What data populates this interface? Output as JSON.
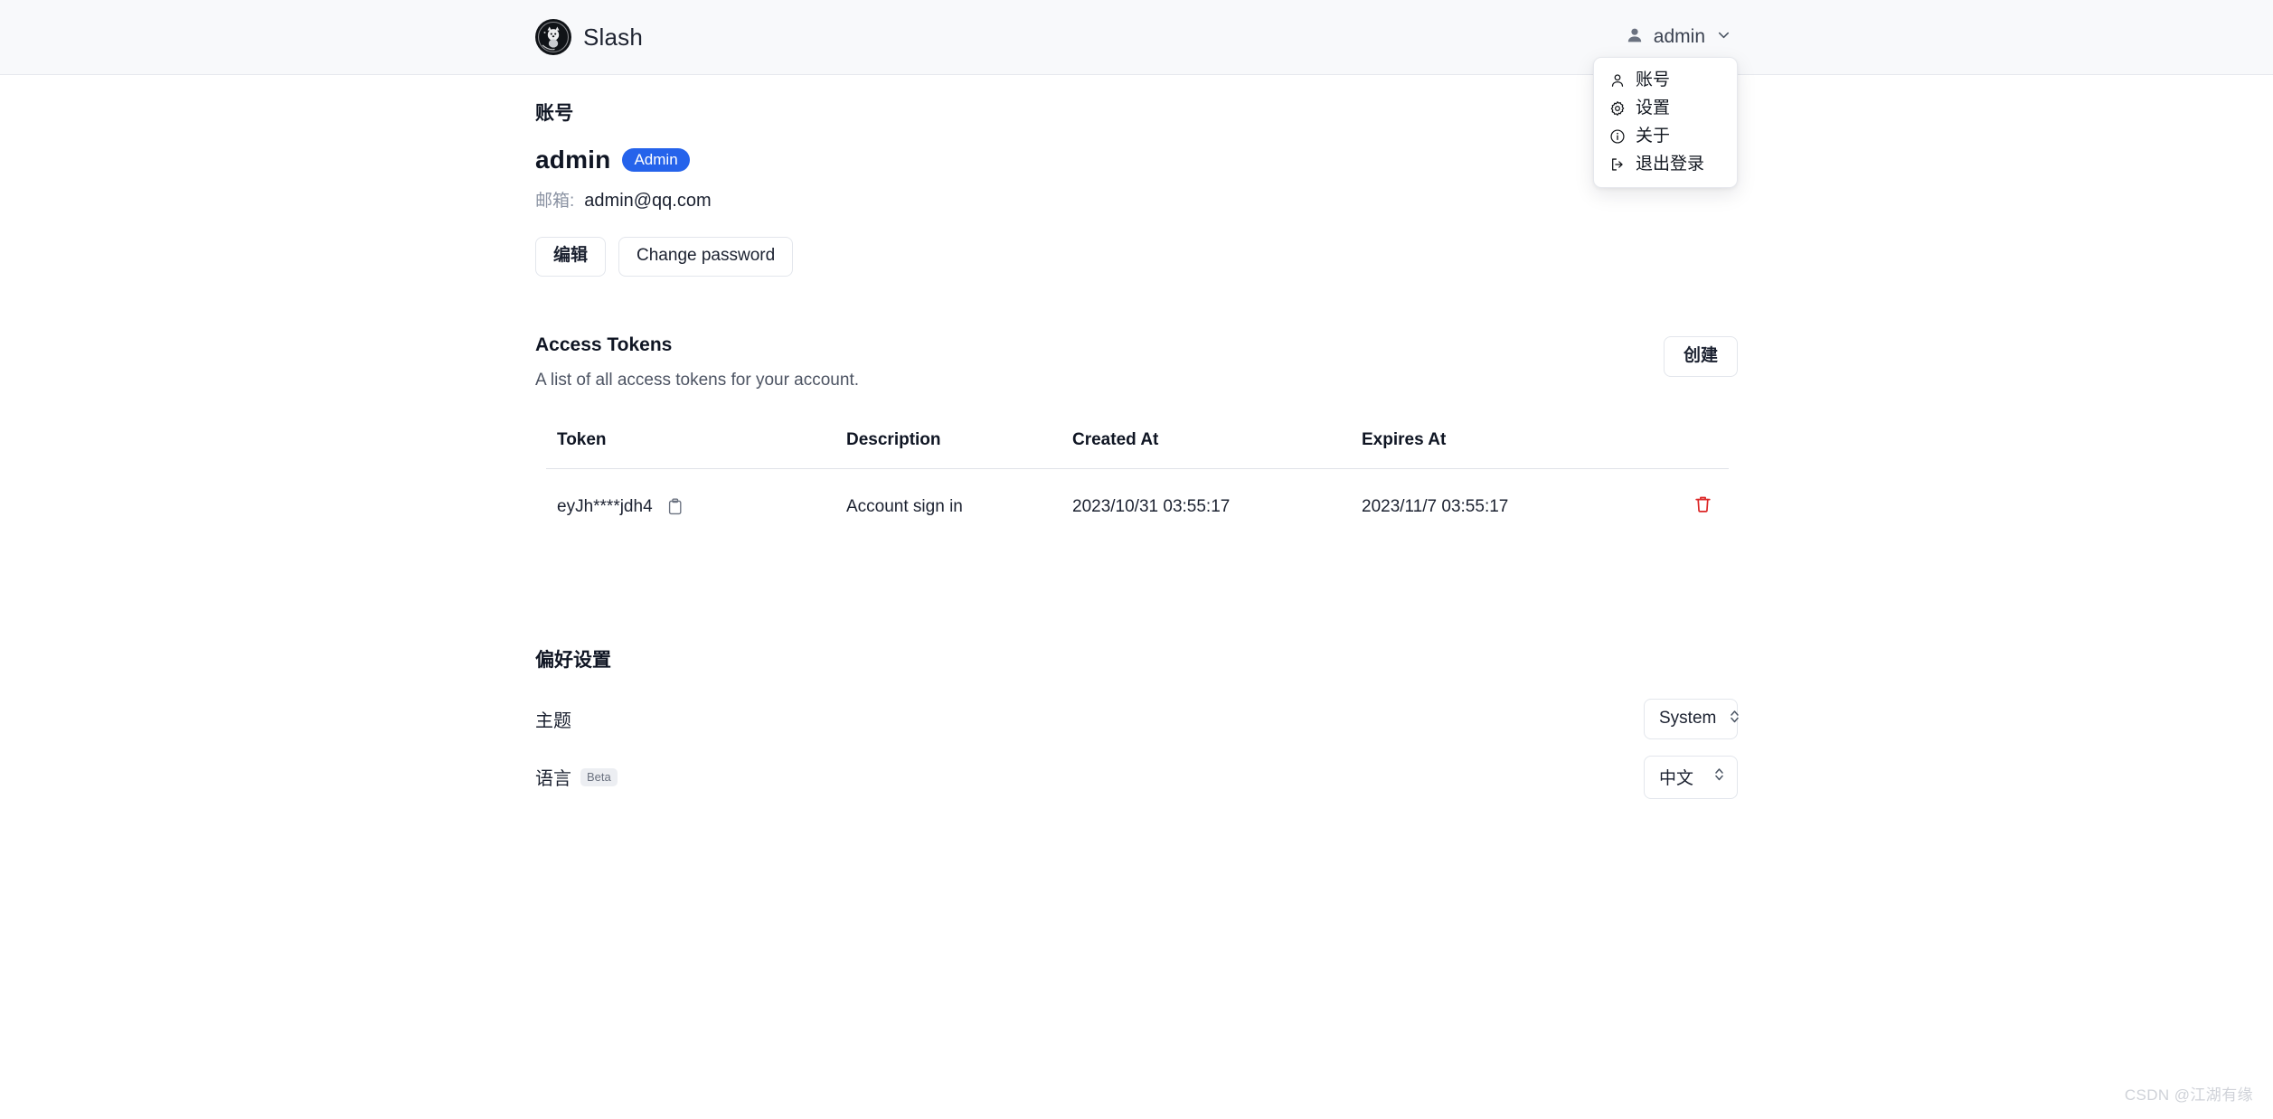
{
  "header": {
    "brand_name": "Slash",
    "logo_icon": "corgi-circle-logo",
    "user_name": "admin",
    "user_icon": "person-filled-icon",
    "chevron_icon": "chevron-down-icon"
  },
  "user_dropdown": {
    "items": [
      {
        "label": "账号",
        "icon": "person-icon"
      },
      {
        "label": "设置",
        "icon": "gear-icon"
      },
      {
        "label": "关于",
        "icon": "info-circle-icon"
      },
      {
        "label": "退出登录",
        "icon": "logout-icon"
      }
    ]
  },
  "account": {
    "section_title": "账号",
    "username": "admin",
    "role_badge": "Admin",
    "email_label": "邮箱:",
    "email_value": "admin@qq.com",
    "edit_button": "编辑",
    "change_password_button": "Change password"
  },
  "access_tokens": {
    "title": "Access Tokens",
    "subtitle": "A list of all access tokens for your account.",
    "create_button": "创建",
    "columns": [
      "Token",
      "Description",
      "Created At",
      "Expires At"
    ],
    "copy_icon": "clipboard-icon",
    "delete_icon": "trash-icon",
    "rows": [
      {
        "token": "eyJh****jdh4",
        "description": "Account sign in",
        "created_at": "2023/10/31 03:55:17",
        "expires_at": "2023/11/7 03:55:17"
      }
    ]
  },
  "preferences": {
    "title": "偏好设置",
    "theme_label": "主题",
    "theme_value": "System",
    "language_label": "语言",
    "language_beta_tag": "Beta",
    "language_value": "中文",
    "select_icon": "chevron-up-down-icon"
  },
  "watermark": "CSDN @江湖有缘",
  "colors": {
    "badge_blue": "#2563eb",
    "delete_red": "#dc2626",
    "header_bg": "#f8f9fb",
    "text_primary": "#0f1523",
    "text_muted": "#77808f"
  }
}
